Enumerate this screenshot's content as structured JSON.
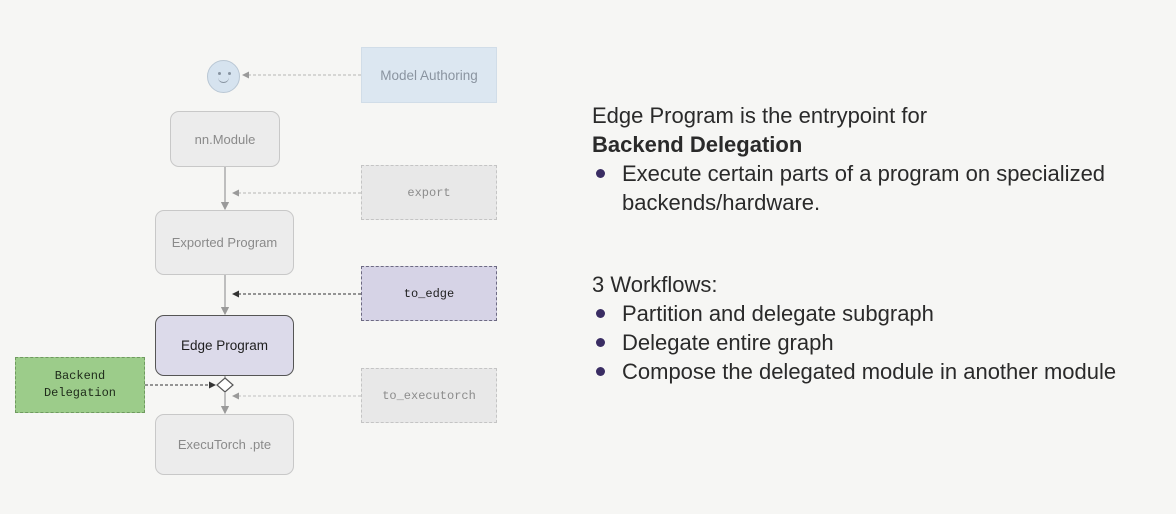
{
  "diagram": {
    "model_authoring": "Model Authoring",
    "nn_module": "nn.Module",
    "export": "export",
    "exported_program": "Exported Program",
    "to_edge": "to_edge",
    "edge_program": "Edge Program",
    "backend_delegation": [
      "Backend",
      "Delegation"
    ],
    "to_executorch": "to_executorch",
    "executorch_pte": "ExecuTorch .pte"
  },
  "panel": {
    "intro_line": "Edge Program is the entrypoint for",
    "intro_bold": "Backend Delegation",
    "bullets1": [
      "Execute certain parts of a program on specialized backends/hardware."
    ],
    "workflows_heading": "3 Workflows:",
    "bullets2": [
      "Partition and delegate subgraph",
      "Delegate entire graph",
      "Compose the delegated module in another module"
    ]
  },
  "colors": {
    "accent_purple": "#3a2d63",
    "active_node": "#dcdaea",
    "delegation_green": "#9ccc8a",
    "authoring_blue": "#dce7f1"
  }
}
